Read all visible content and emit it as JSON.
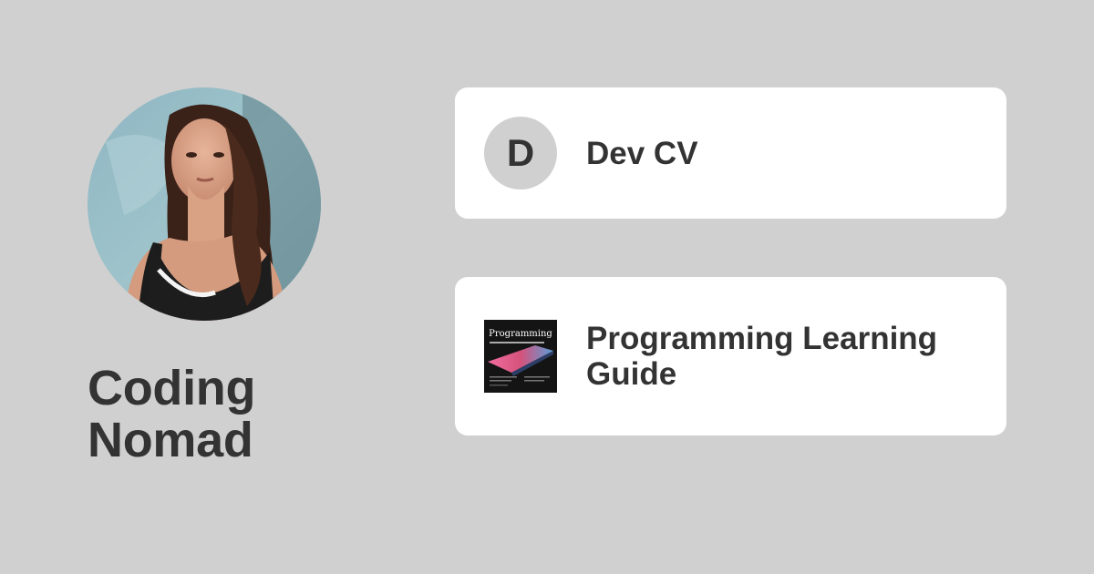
{
  "profile": {
    "name": "Coding Nomad",
    "avatar_icon": "profile-photo"
  },
  "links": [
    {
      "badge_letter": "D",
      "title": "Dev CV",
      "icon": "letter-badge"
    },
    {
      "title": "Programming Learning Guide",
      "icon": "book-cover-thumbnail",
      "thumb_caption": "Programming"
    }
  ],
  "colors": {
    "background": "#d0d0d0",
    "card": "#ffffff",
    "text": "#333333",
    "badge": "#d0d0d0"
  }
}
